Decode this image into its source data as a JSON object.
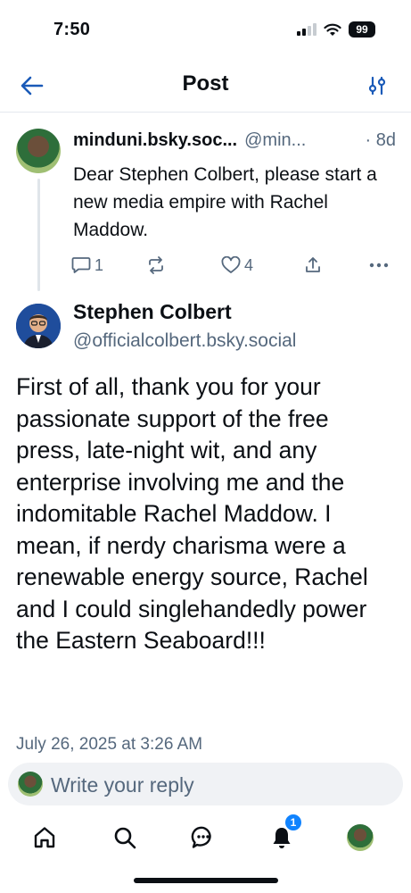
{
  "status_bar": {
    "time": "7:50",
    "battery": "99"
  },
  "header": {
    "title": "Post"
  },
  "parent_post": {
    "author_name": "minduni.bsky.soc...",
    "author_handle": "@min...",
    "age": "· 8d",
    "text": "Dear Stephen Colbert, please start a new media empire with Rachel Maddow.",
    "reply_count": "1",
    "like_count": "4"
  },
  "main_post": {
    "author_name": "Stephen Colbert",
    "author_handle": "@officialcolbert.bsky.social",
    "text": "First of all, thank you for your passionate support of the free press, late-night wit, and any enterprise involving me and the indomitable Rachel Maddow. I mean, if nerdy charisma were a renewable energy source, Rachel and I could singlehandedly power the Eastern Seaboard!!!",
    "timestamp": "July 26, 2025 at 3:26 AM"
  },
  "reply": {
    "placeholder": "Write your reply"
  },
  "nav": {
    "notifications_badge": "1"
  },
  "colors": {
    "accent": "#1083fe",
    "muted": "#55687d",
    "text": "#0b0f14",
    "divider": "#e4e8ee"
  }
}
